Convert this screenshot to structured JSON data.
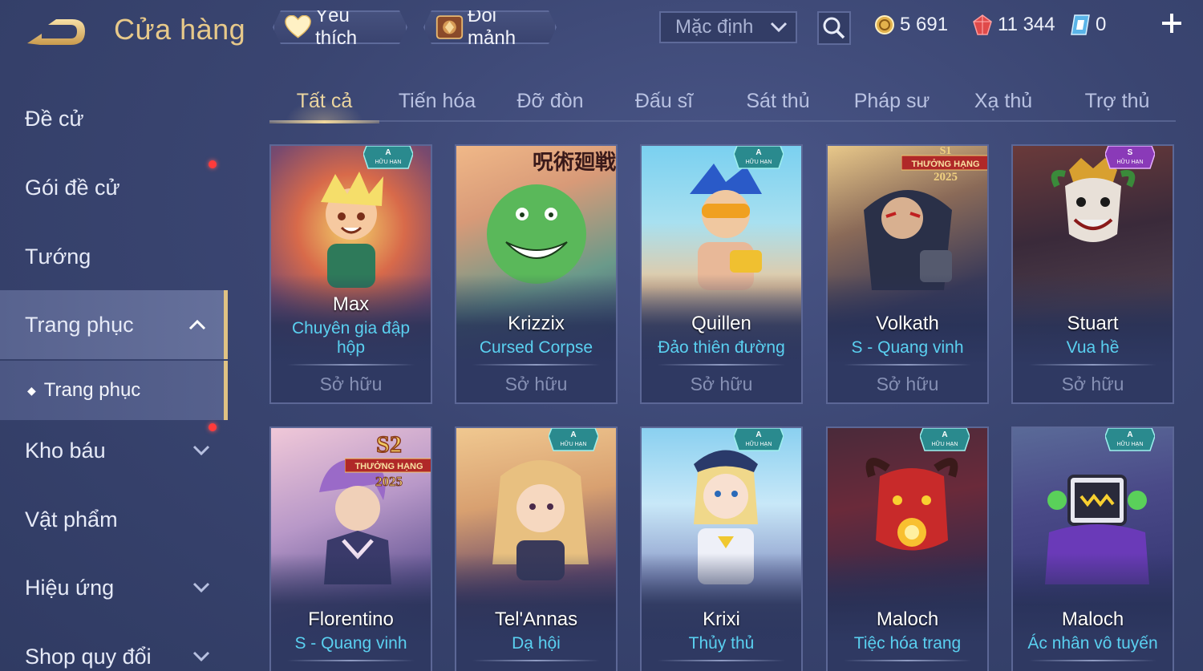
{
  "header": {
    "title": "Cửa hàng",
    "favorite_label": "Yêu thích",
    "exchange_label": "Đổi mảnh",
    "sort_value": "Mặc định",
    "currencies": {
      "gold": "5 691",
      "gems": "11 344",
      "vouchers": "0"
    }
  },
  "sidebar": {
    "items": [
      {
        "label": "Đề cử"
      },
      {
        "label": "Gói đề cử"
      },
      {
        "label": "Tướng"
      },
      {
        "label": "Trang phục"
      },
      {
        "label": "Trang phục"
      },
      {
        "label": "Kho báu"
      },
      {
        "label": "Vật phẩm"
      },
      {
        "label": "Hiệu ứng"
      },
      {
        "label": "Shop quy đổi"
      }
    ]
  },
  "tabs": [
    {
      "label": "Tất cả"
    },
    {
      "label": "Tiến hóa"
    },
    {
      "label": "Đỡ đòn"
    },
    {
      "label": "Đấu sĩ"
    },
    {
      "label": "Sát thủ"
    },
    {
      "label": "Pháp sư"
    },
    {
      "label": "Xạ thủ"
    },
    {
      "label": "Trợ thủ"
    }
  ],
  "badges": {
    "limited": "HỮU HẠN",
    "rank_reward": "THƯỞNG HẠNG",
    "rank_year": "2025",
    "rank_s1": "S1",
    "rank_s2": "S2",
    "banner_text": "呪術廻戦"
  },
  "cards": [
    {
      "hero": "Max",
      "skin": "Chuyên gia đập hộp",
      "status": "Sở hữu",
      "grade": "A"
    },
    {
      "hero": "Krizzix",
      "skin": "Cursed Corpse",
      "status": "Sở hữu",
      "grade": ""
    },
    {
      "hero": "Quillen",
      "skin": "Đảo thiên đường",
      "status": "Sở hữu",
      "grade": "A"
    },
    {
      "hero": "Volkath",
      "skin": "S - Quang vinh",
      "status": "Sở hữu",
      "grade": ""
    },
    {
      "hero": "Stuart",
      "skin": "Vua hề",
      "status": "Sở hữu",
      "grade": "S"
    },
    {
      "hero": "Florentino",
      "skin": "S - Quang vinh",
      "status": "",
      "grade": ""
    },
    {
      "hero": "Tel'Annas",
      "skin": "Dạ hội",
      "status": "",
      "grade": "A"
    },
    {
      "hero": "Krixi",
      "skin": "Thủy thủ",
      "status": "",
      "grade": "A"
    },
    {
      "hero": "Maloch",
      "skin": "Tiệc hóa trang",
      "status": "",
      "grade": "A"
    },
    {
      "hero": "Maloch",
      "skin": "Ác nhân vô tuyến",
      "status": "",
      "grade": "A"
    }
  ]
}
